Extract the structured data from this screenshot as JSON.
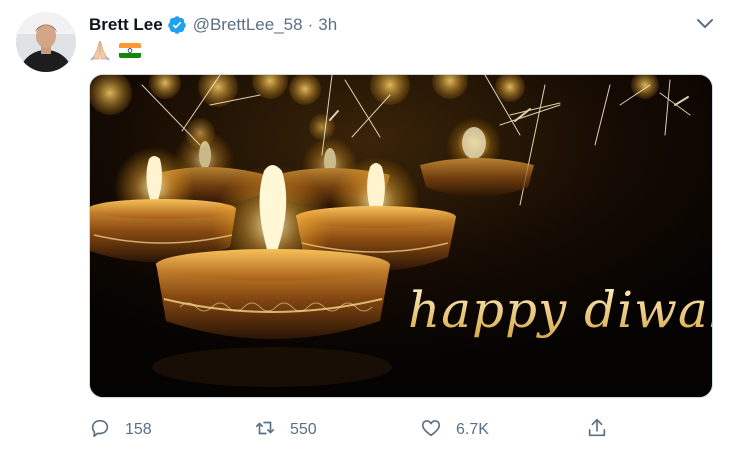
{
  "tweet": {
    "author_name": "Brett Lee",
    "handle": "@BrettLee_58",
    "separator": "·",
    "time": "3h",
    "verified": true,
    "text_icons": [
      "folded-hands-emoji",
      "india-flag-emoji"
    ],
    "media": {
      "overlay_text": "happy diwali",
      "description_colors": {
        "accent": "#f2b544",
        "background": "#0b0603"
      }
    },
    "actions": {
      "replies": "158",
      "retweets": "550",
      "likes": "6.7K"
    }
  },
  "colors": {
    "verified_blue": "#1da1f2",
    "secondary_text": "#5b7083",
    "primary_text": "#0f1419"
  }
}
